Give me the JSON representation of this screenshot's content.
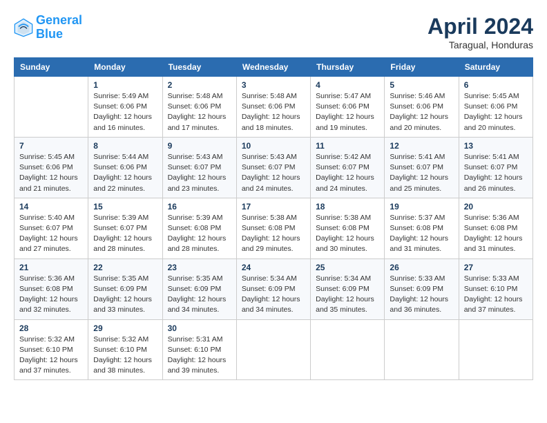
{
  "header": {
    "logo_line1": "General",
    "logo_line2": "Blue",
    "title": "April 2024",
    "subtitle": "Taragual, Honduras"
  },
  "calendar": {
    "headers": [
      "Sunday",
      "Monday",
      "Tuesday",
      "Wednesday",
      "Thursday",
      "Friday",
      "Saturday"
    ],
    "weeks": [
      [
        {
          "day": "",
          "info": ""
        },
        {
          "day": "1",
          "info": "Sunrise: 5:49 AM\nSunset: 6:06 PM\nDaylight: 12 hours\nand 16 minutes."
        },
        {
          "day": "2",
          "info": "Sunrise: 5:48 AM\nSunset: 6:06 PM\nDaylight: 12 hours\nand 17 minutes."
        },
        {
          "day": "3",
          "info": "Sunrise: 5:48 AM\nSunset: 6:06 PM\nDaylight: 12 hours\nand 18 minutes."
        },
        {
          "day": "4",
          "info": "Sunrise: 5:47 AM\nSunset: 6:06 PM\nDaylight: 12 hours\nand 19 minutes."
        },
        {
          "day": "5",
          "info": "Sunrise: 5:46 AM\nSunset: 6:06 PM\nDaylight: 12 hours\nand 20 minutes."
        },
        {
          "day": "6",
          "info": "Sunrise: 5:45 AM\nSunset: 6:06 PM\nDaylight: 12 hours\nand 20 minutes."
        }
      ],
      [
        {
          "day": "7",
          "info": "Sunrise: 5:45 AM\nSunset: 6:06 PM\nDaylight: 12 hours\nand 21 minutes."
        },
        {
          "day": "8",
          "info": "Sunrise: 5:44 AM\nSunset: 6:06 PM\nDaylight: 12 hours\nand 22 minutes."
        },
        {
          "day": "9",
          "info": "Sunrise: 5:43 AM\nSunset: 6:07 PM\nDaylight: 12 hours\nand 23 minutes."
        },
        {
          "day": "10",
          "info": "Sunrise: 5:43 AM\nSunset: 6:07 PM\nDaylight: 12 hours\nand 24 minutes."
        },
        {
          "day": "11",
          "info": "Sunrise: 5:42 AM\nSunset: 6:07 PM\nDaylight: 12 hours\nand 24 minutes."
        },
        {
          "day": "12",
          "info": "Sunrise: 5:41 AM\nSunset: 6:07 PM\nDaylight: 12 hours\nand 25 minutes."
        },
        {
          "day": "13",
          "info": "Sunrise: 5:41 AM\nSunset: 6:07 PM\nDaylight: 12 hours\nand 26 minutes."
        }
      ],
      [
        {
          "day": "14",
          "info": "Sunrise: 5:40 AM\nSunset: 6:07 PM\nDaylight: 12 hours\nand 27 minutes."
        },
        {
          "day": "15",
          "info": "Sunrise: 5:39 AM\nSunset: 6:07 PM\nDaylight: 12 hours\nand 28 minutes."
        },
        {
          "day": "16",
          "info": "Sunrise: 5:39 AM\nSunset: 6:08 PM\nDaylight: 12 hours\nand 28 minutes."
        },
        {
          "day": "17",
          "info": "Sunrise: 5:38 AM\nSunset: 6:08 PM\nDaylight: 12 hours\nand 29 minutes."
        },
        {
          "day": "18",
          "info": "Sunrise: 5:38 AM\nSunset: 6:08 PM\nDaylight: 12 hours\nand 30 minutes."
        },
        {
          "day": "19",
          "info": "Sunrise: 5:37 AM\nSunset: 6:08 PM\nDaylight: 12 hours\nand 31 minutes."
        },
        {
          "day": "20",
          "info": "Sunrise: 5:36 AM\nSunset: 6:08 PM\nDaylight: 12 hours\nand 31 minutes."
        }
      ],
      [
        {
          "day": "21",
          "info": "Sunrise: 5:36 AM\nSunset: 6:08 PM\nDaylight: 12 hours\nand 32 minutes."
        },
        {
          "day": "22",
          "info": "Sunrise: 5:35 AM\nSunset: 6:09 PM\nDaylight: 12 hours\nand 33 minutes."
        },
        {
          "day": "23",
          "info": "Sunrise: 5:35 AM\nSunset: 6:09 PM\nDaylight: 12 hours\nand 34 minutes."
        },
        {
          "day": "24",
          "info": "Sunrise: 5:34 AM\nSunset: 6:09 PM\nDaylight: 12 hours\nand 34 minutes."
        },
        {
          "day": "25",
          "info": "Sunrise: 5:34 AM\nSunset: 6:09 PM\nDaylight: 12 hours\nand 35 minutes."
        },
        {
          "day": "26",
          "info": "Sunrise: 5:33 AM\nSunset: 6:09 PM\nDaylight: 12 hours\nand 36 minutes."
        },
        {
          "day": "27",
          "info": "Sunrise: 5:33 AM\nSunset: 6:10 PM\nDaylight: 12 hours\nand 37 minutes."
        }
      ],
      [
        {
          "day": "28",
          "info": "Sunrise: 5:32 AM\nSunset: 6:10 PM\nDaylight: 12 hours\nand 37 minutes."
        },
        {
          "day": "29",
          "info": "Sunrise: 5:32 AM\nSunset: 6:10 PM\nDaylight: 12 hours\nand 38 minutes."
        },
        {
          "day": "30",
          "info": "Sunrise: 5:31 AM\nSunset: 6:10 PM\nDaylight: 12 hours\nand 39 minutes."
        },
        {
          "day": "",
          "info": ""
        },
        {
          "day": "",
          "info": ""
        },
        {
          "day": "",
          "info": ""
        },
        {
          "day": "",
          "info": ""
        }
      ]
    ]
  }
}
